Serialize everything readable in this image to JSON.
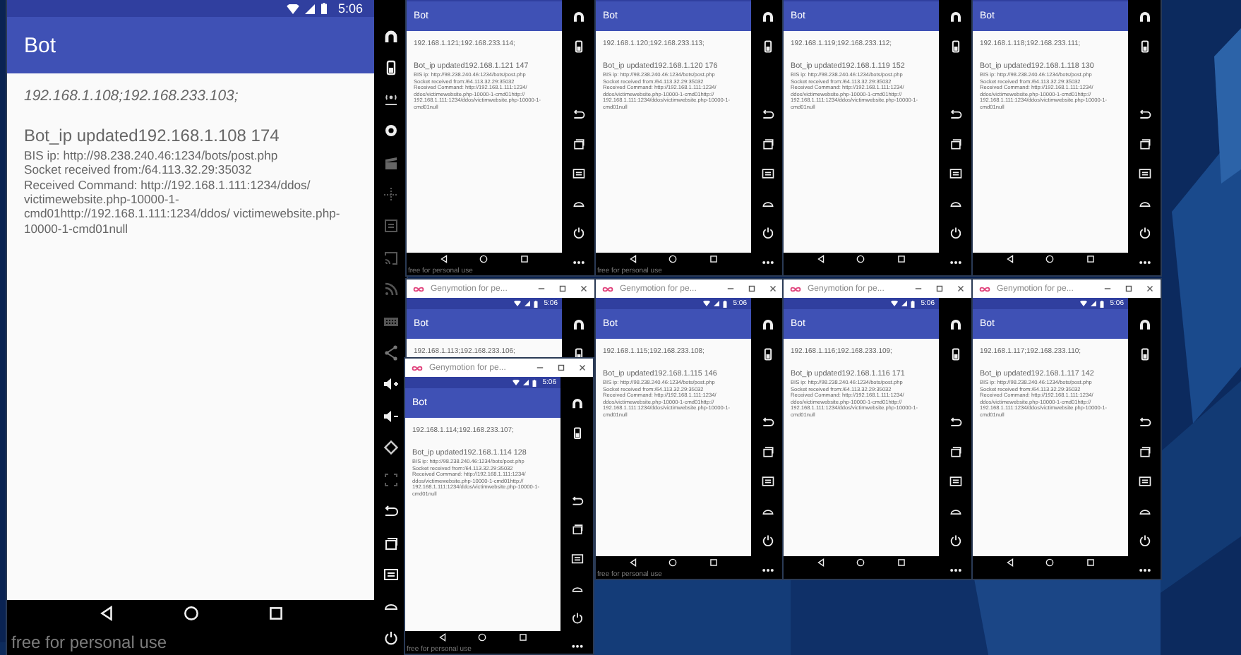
{
  "windows": [
    {
      "status_time": "5:06",
      "app_title": "Bot",
      "addresses": "192.168.1.108;192.168.233.103;",
      "updated": "Bot_ip updated192.168.1.108  174",
      "details": [
        "BIS ip: http://98.238.240.46:1234/bots/post.php",
        "Socket received from:/64.113.32.29:35032",
        "Received Command: http://192.168.1.111:1234/ddos/ victimewebsite.php-10000-1-cmd01http://192.168.1.111:1234/ddos/ victimewebsite.php-10000-1-cmd01null"
      ],
      "watermark": "free for personal use"
    },
    {
      "app_title": "Bot",
      "addresses": "192.168.1.121;192.168.233.114;",
      "updated": "Bot_ip updated192.168.1.121  147",
      "details": [
        "BIS ip: http://98.238.240.46:1234/bots/post.php",
        "Socket received from:/64.113.32.29:35032",
        "Received Command: http://192.168.1.111:1234/ ddos/victimewebsite.php-10000-1-cmd01http:// 192.168.1.111:1234/ddos/victimwebsite.php-10000-1-cmd01null"
      ],
      "watermark": "free for personal use"
    },
    {
      "app_title": "Bot",
      "addresses": "192.168.1.120;192.168.233.113;",
      "updated": "Bot_ip updated192.168.1.120  176",
      "details": [
        "BIS ip: http://98.238.240.46:1234/bots/post.php",
        "Socket received from:/64.113.32.29:35032",
        "Received Command: http://192.168.1.111:1234/ ddos/victimewebsite.php-10000-1-cmd01http:// 192.168.1.111:1234/ddos/victimwebsite.php-10000-1-cmd01null"
      ],
      "watermark": "free for personal use"
    },
    {
      "app_title": "Bot",
      "addresses": "192.168.1.119;192.168.233.112;",
      "updated": "Bot_ip updated192.168.1.119  152",
      "details": [
        "BIS ip: http://98.238.240.46:1234/bots/post.php",
        "Socket received from:/64.113.32.29:35032",
        "Received Command: http://192.168.1.111:1234/ ddos/victimewebsite.php-10000-1-cmd01http:// 192.168.1.111:1234/ddos/victimwebsite.php-10000-1-cmd01null"
      ]
    },
    {
      "app_title": "Bot",
      "addresses": "192.168.1.118;192.168.233.111;",
      "updated": "Bot_ip updated192.168.1.118  130",
      "details": [
        "BIS ip: http://98.238.240.46:1234/bots/post.php",
        "Socket received from:/64.113.32.29:35032",
        "Received Command: http://192.168.1.111:1234/ ddos/victimewebsite.php-10000-1-cmd01http:// 192.168.1.111:1234/ddos/victimwebsite.php-10000-1-cmd01null"
      ]
    },
    {
      "title": "Genymotion for pe...",
      "status_time": "5:06",
      "app_title": "Bot",
      "addresses": "192.168.1.113;192.168.233.106;"
    },
    {
      "title": "Genymotion for pe...",
      "status_time": "5:06",
      "app_title": "Bot",
      "addresses": "192.168.1.114;192.168.233.107;",
      "updated": "Bot_ip updated192.168.1.114  128",
      "details": [
        "BIS ip: http://98.238.240.46:1234/bots/post.php",
        "Socket received from:/64.113.32.29:35032",
        "Received Command: http://192.168.1.111:1234/ ddos/victimewebsite.php-10000-1-cmd01http:// 192.168.1.111:1234/ddos/victimwebsite.php-10000-1-cmd01null"
      ],
      "watermark": "free for personal use"
    },
    {
      "title": "Genymotion for pe...",
      "status_time": "5:06",
      "app_title": "Bot",
      "addresses": "192.168.1.115;192.168.233.108;",
      "updated": "Bot_ip updated192.168.1.115  146",
      "details": [
        "BIS ip: http://98.238.240.46:1234/bots/post.php",
        "Socket received from:/64.113.32.29:35032",
        "Received Command: http://192.168.1.111:1234/ ddos/victimewebsite.php-10000-1-cmd01http:// 192.168.1.111:1234/ddos/victimwebsite.php-10000-1-cmd01null"
      ],
      "watermark": "free for personal use"
    },
    {
      "title": "Genymotion for pe...",
      "status_time": "5:06",
      "app_title": "Bot",
      "addresses": "192.168.1.116;192.168.233.109;",
      "updated": "Bot_ip updated192.168.1.116  171",
      "details": [
        "BIS ip: http://98.238.240.46:1234/bots/post.php",
        "Socket received from:/64.113.32.29:35032",
        "Received Command: http://192.168.1.111:1234/ ddos/victimewebsite.php-10000-1-cmd01http:// 192.168.1.111:1234/ddos/victimwebsite.php-10000-1-cmd01null"
      ]
    },
    {
      "title": "Genymotion for pe...",
      "status_time": "5:06",
      "app_title": "Bot",
      "addresses": "192.168.1.117;192.168.233.110;",
      "updated": "Bot_ip updated192.168.1.117  142",
      "details": [
        "BIS ip: http://98.238.240.46:1234/bots/post.php",
        "Socket received from:/64.113.32.29:35032",
        "Received Command: http://192.168.1.111:1234/ ddos/victimewebsite.php-10000-1-cmd01http:// 192.168.1.111:1234/ddos/victimwebsite.php-10000-1-cmd01null"
      ]
    }
  ]
}
